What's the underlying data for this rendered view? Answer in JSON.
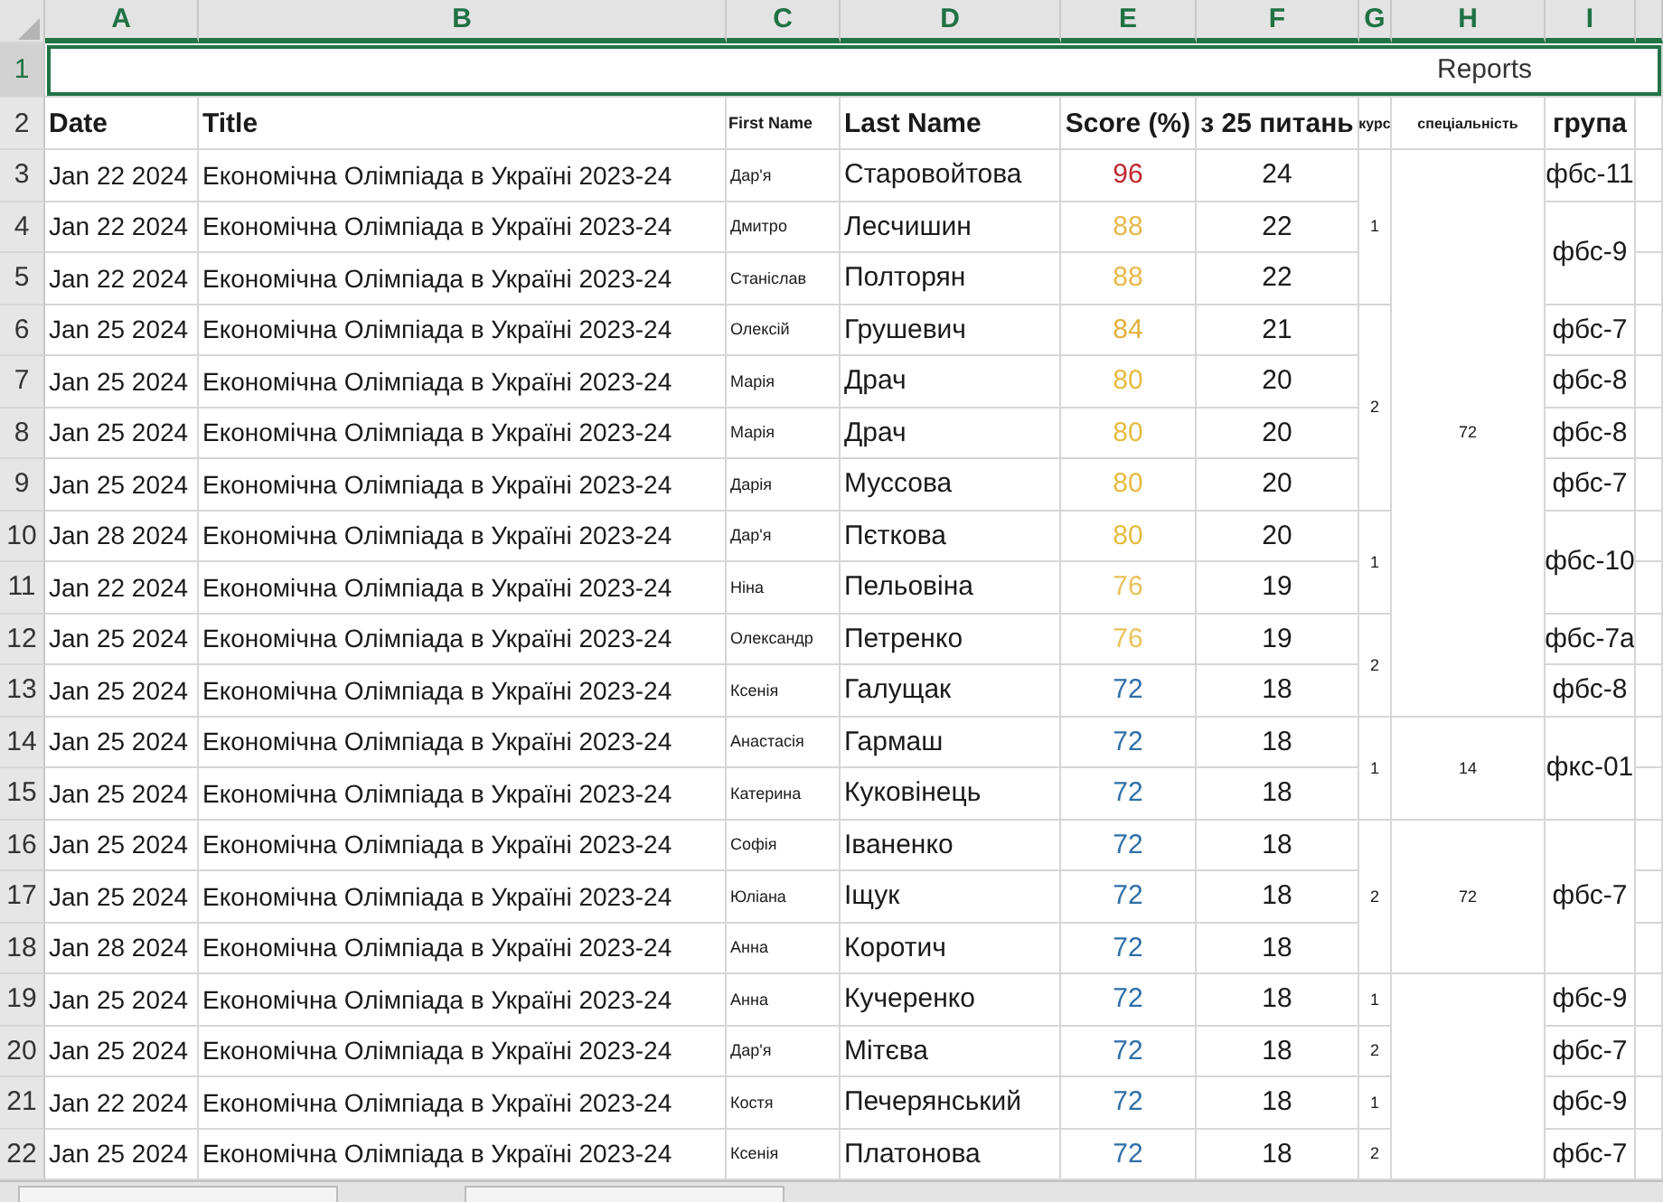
{
  "column_headers": [
    "A",
    "B",
    "C",
    "D",
    "E",
    "F",
    "G",
    "H",
    "I"
  ],
  "title_row": {
    "number": "1",
    "text": "Reports",
    "selected": true
  },
  "header_row": {
    "number": "2",
    "cells": [
      "Date",
      "Title",
      "First Name",
      "Last Name",
      "Score (%)",
      "з 25 питань",
      "курс",
      "спеціальність",
      "група"
    ]
  },
  "specialty_groups": [
    {
      "specialty": "72",
      "course_groups": [
        {
          "course": "1",
          "group_blocks": [
            {
              "group": "фбс-11",
              "rows": [
                {
                  "number": "3",
                  "date": "Jan 22 2024",
                  "title": "Економічна Олімпіада в Україні 2023-24",
                  "first_name": "Дар'я",
                  "last_name": "Старовойтова",
                  "score": "96",
                  "color": "#c0262d",
                  "answers": "24"
                }
              ]
            },
            {
              "group": "фбс-9",
              "rows": [
                {
                  "number": "4",
                  "date": "Jan 22 2024",
                  "title": "Економічна Олімпіада в Україні 2023-24",
                  "first_name": "Дмитро",
                  "last_name": "Лесчишин",
                  "score": "88",
                  "color": "#e8b84a",
                  "answers": "22"
                },
                {
                  "number": "5",
                  "date": "Jan 22 2024",
                  "title": "Економічна Олімпіада в Україні 2023-24",
                  "first_name": "Станіслав",
                  "last_name": "Полторян",
                  "score": "88",
                  "color": "#e8b84a",
                  "answers": "22"
                }
              ]
            }
          ]
        },
        {
          "course": "2",
          "group_blocks": [
            {
              "group": "фбс-7",
              "rows": [
                {
                  "number": "6",
                  "date": "Jan 25 2024",
                  "title": "Економічна Олімпіада в Україні 2023-24",
                  "first_name": "Олексій",
                  "last_name": "Грушевич",
                  "score": "84",
                  "color": "#e3b03a",
                  "answers": "21"
                }
              ]
            },
            {
              "group": "фбс-8",
              "rows": [
                {
                  "number": "7",
                  "date": "Jan 25 2024",
                  "title": "Економічна Олімпіада в Україні 2023-24",
                  "first_name": "Марія",
                  "last_name": "Драч",
                  "score": "80",
                  "color": "#e6bb3f",
                  "answers": "20"
                }
              ]
            },
            {
              "group": "фбс-8",
              "rows": [
                {
                  "number": "8",
                  "date": "Jan 25 2024",
                  "title": "Економічна Олімпіада в Україні 2023-24",
                  "first_name": "Марія",
                  "last_name": "Драч",
                  "score": "80",
                  "color": "#e6bb3f",
                  "answers": "20"
                }
              ]
            },
            {
              "group": "фбс-7",
              "rows": [
                {
                  "number": "9",
                  "date": "Jan 25 2024",
                  "title": "Економічна Олімпіада в Україні 2023-24",
                  "first_name": "Дарія",
                  "last_name": "Муссова",
                  "score": "80",
                  "color": "#e6bb3f",
                  "answers": "20"
                }
              ]
            }
          ]
        },
        {
          "course": "1",
          "group_blocks": [
            {
              "group": "фбс-10",
              "rows": [
                {
                  "number": "10",
                  "date": "Jan 28 2024",
                  "title": "Економічна Олімпіада в Україні 2023-24",
                  "first_name": "Дар'я",
                  "last_name": "Пєткова",
                  "score": "80",
                  "color": "#e6bb3f",
                  "answers": "20"
                },
                {
                  "number": "11",
                  "date": "Jan 22 2024",
                  "title": "Економічна Олімпіада в Україні 2023-24",
                  "first_name": "Ніна",
                  "last_name": "Пельовіна",
                  "score": "76",
                  "color": "#e9c25a",
                  "answers": "19"
                }
              ]
            }
          ]
        },
        {
          "course": "2",
          "group_blocks": [
            {
              "group": "фбс-7а",
              "rows": [
                {
                  "number": "12",
                  "date": "Jan 25 2024",
                  "title": "Економічна Олімпіада в Україні 2023-24",
                  "first_name": "Олександр",
                  "last_name": "Петренко",
                  "score": "76",
                  "color": "#e9c25a",
                  "answers": "19"
                }
              ]
            },
            {
              "group": "фбс-8",
              "rows": [
                {
                  "number": "13",
                  "date": "Jan 25 2024",
                  "title": "Економічна Олімпіада в Україні 2023-24",
                  "first_name": "Ксенія",
                  "last_name": "Галущак",
                  "score": "72",
                  "color": "#2f6fa8",
                  "answers": "18"
                }
              ]
            }
          ]
        }
      ]
    },
    {
      "specialty": "14",
      "course_groups": [
        {
          "course": "1",
          "group_blocks": [
            {
              "group": "фкс-01",
              "rows": [
                {
                  "number": "14",
                  "date": "Jan 25 2024",
                  "title": "Економічна Олімпіада в Україні 2023-24",
                  "first_name": "Анастасія",
                  "last_name": "Гармаш",
                  "score": "72",
                  "color": "#2f6fa8",
                  "answers": "18"
                },
                {
                  "number": "15",
                  "date": "Jan 25 2024",
                  "title": "Економічна Олімпіада в Україні 2023-24",
                  "first_name": "Катерина",
                  "last_name": "Куковінець",
                  "score": "72",
                  "color": "#2f6fa8",
                  "answers": "18"
                }
              ]
            }
          ]
        }
      ]
    },
    {
      "specialty": "72",
      "course_groups": [
        {
          "course": "2",
          "group_blocks": [
            {
              "group": "фбс-7",
              "rows": [
                {
                  "number": "16",
                  "date": "Jan 25 2024",
                  "title": "Економічна Олімпіада в Україні 2023-24",
                  "first_name": "Софія",
                  "last_name": "Іваненко",
                  "score": "72",
                  "color": "#2f6fa8",
                  "answers": "18"
                },
                {
                  "number": "17",
                  "date": "Jan 25 2024",
                  "title": "Економічна Олімпіада в Україні 2023-24",
                  "first_name": "Юліана",
                  "last_name": "Іщук",
                  "score": "72",
                  "color": "#2f6fa8",
                  "answers": "18"
                },
                {
                  "number": "18",
                  "date": "Jan 28 2024",
                  "title": "Економічна Олімпіада в Україні 2023-24",
                  "first_name": "Анна",
                  "last_name": "Коротич",
                  "score": "72",
                  "color": "#2f6fa8",
                  "answers": "18"
                }
              ]
            }
          ]
        }
      ]
    },
    {
      "course_groups": [
        {
          "course": "1",
          "group_blocks": [
            {
              "group": "фбс-9",
              "rows": [
                {
                  "number": "19",
                  "date": "Jan 25 2024",
                  "title": "Економічна Олімпіада в Україні 2023-24",
                  "first_name": "Анна",
                  "last_name": "Кучеренко",
                  "score": "72",
                  "color": "#2f6fa8",
                  "answers": "18"
                }
              ]
            }
          ]
        },
        {
          "course": "2",
          "group_blocks": [
            {
              "group": "фбс-7",
              "rows": [
                {
                  "number": "20",
                  "date": "Jan 25 2024",
                  "title": "Економічна Олімпіада в Україні 2023-24",
                  "first_name": "Дар'я",
                  "last_name": "Мітєва",
                  "score": "72",
                  "color": "#2f6fa8",
                  "answers": "18"
                }
              ]
            }
          ]
        },
        {
          "course": "1",
          "group_blocks": [
            {
              "group": "фбс-9",
              "rows": [
                {
                  "number": "21",
                  "date": "Jan 22 2024",
                  "title": "Економічна Олімпіада в Україні 2023-24",
                  "first_name": "Костя",
                  "last_name": "Печерянський",
                  "score": "72",
                  "color": "#2f6fa8",
                  "answers": "18"
                }
              ]
            }
          ]
        },
        {
          "course": "2",
          "group_blocks": [
            {
              "group": "фбс-7",
              "rows": [
                {
                  "number": "22",
                  "date": "Jan 25 2024",
                  "title": "Економічна Олімпіада в Україні 2023-24",
                  "first_name": "Ксенія",
                  "last_name": "Платонова",
                  "score": "72",
                  "color": "#2f6fa8",
                  "answers": "18"
                }
              ]
            }
          ]
        }
      ]
    }
  ]
}
